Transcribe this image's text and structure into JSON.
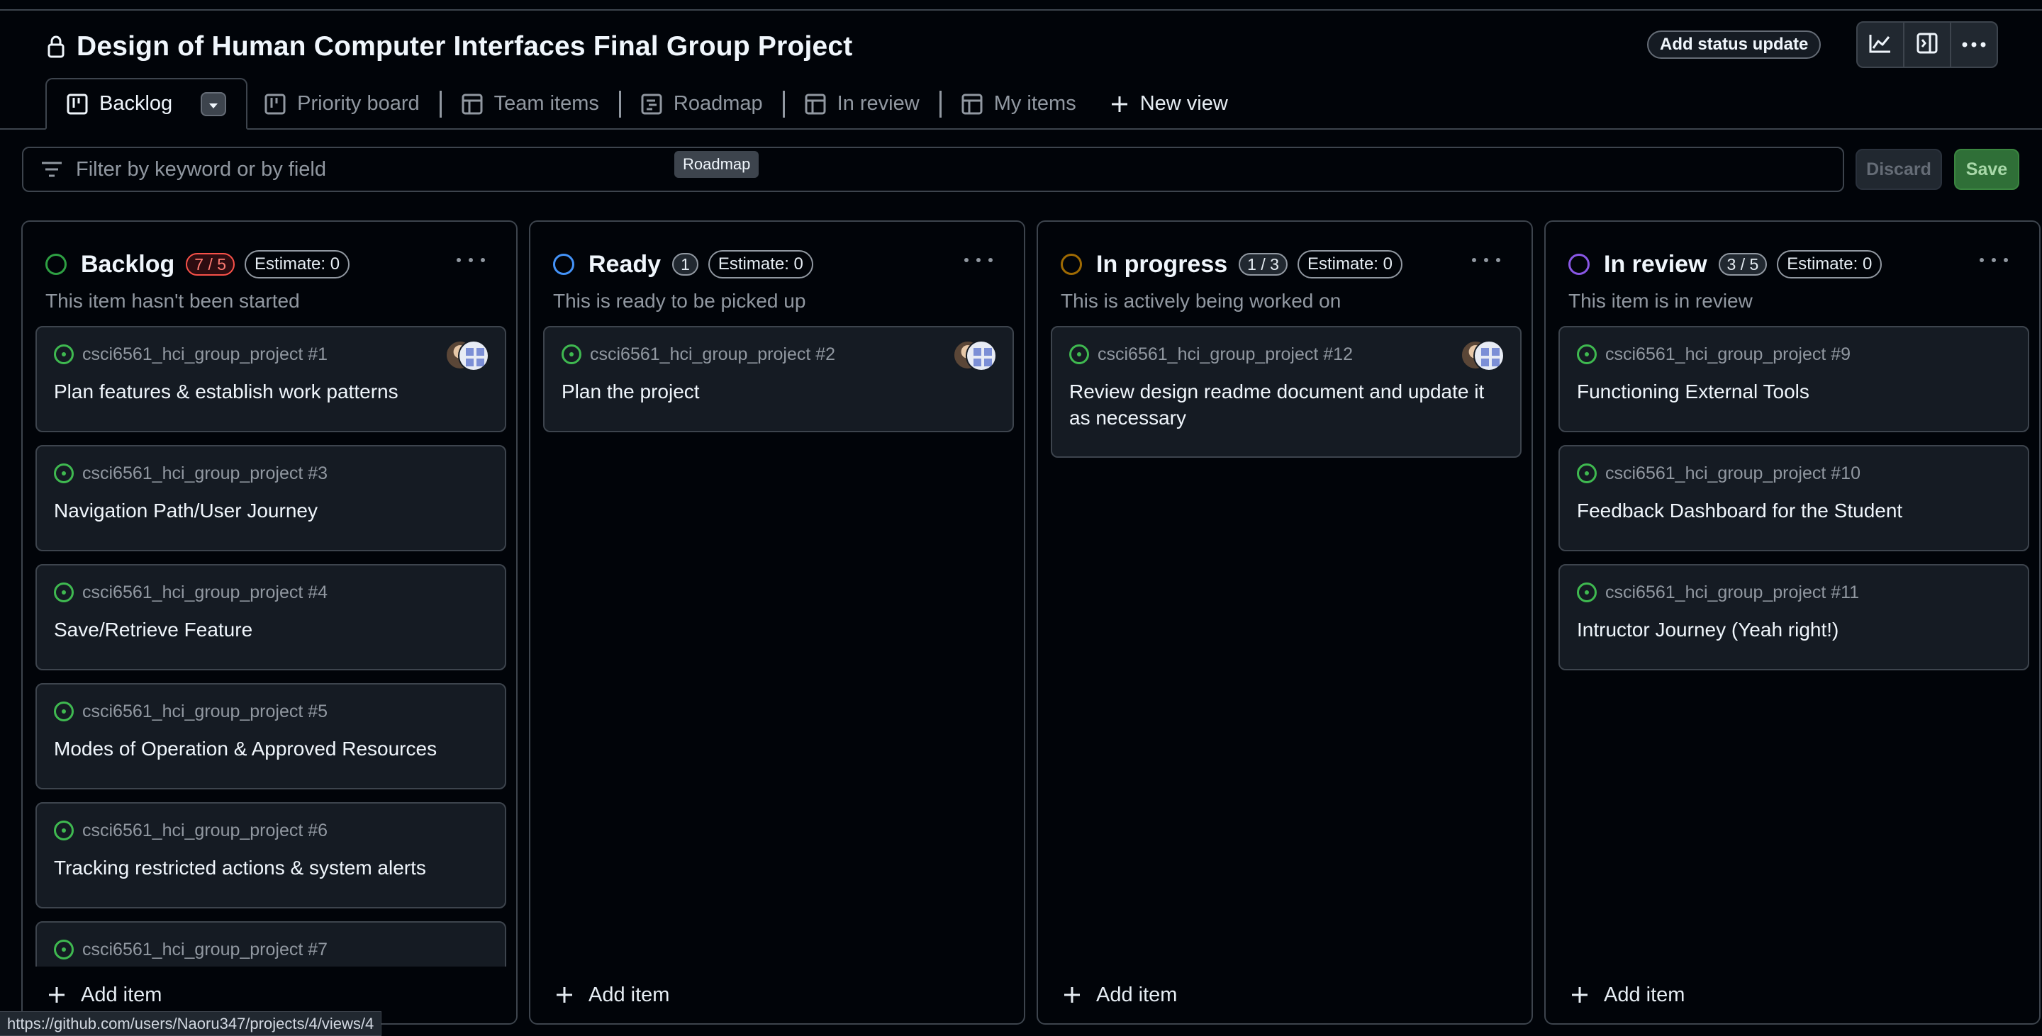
{
  "project": {
    "title": "Design of Human Computer Interfaces Final Group Project",
    "visibility_icon": "lock-icon"
  },
  "header_actions": {
    "status_update_label": "Add status update",
    "insights_icon": "graph-icon",
    "sidepanel_icon": "sidebar-expand-icon",
    "more_icon": "kebab-horizontal-icon"
  },
  "tabs": [
    {
      "label": "Backlog",
      "icon": "board-icon",
      "active": true
    },
    {
      "label": "Priority board",
      "icon": "board-icon"
    },
    {
      "label": "Team items",
      "icon": "table-icon"
    },
    {
      "label": "Roadmap",
      "icon": "roadmap-icon"
    },
    {
      "label": "In review",
      "icon": "table-icon"
    },
    {
      "label": "My items",
      "icon": "table-icon"
    }
  ],
  "new_view_label": "New view",
  "filter": {
    "placeholder": "Filter by keyword or by field"
  },
  "tooltip": "Roadmap",
  "actions": {
    "discard": "Discard",
    "save": "Save"
  },
  "columns": [
    {
      "name": "Backlog",
      "count": "7 / 5",
      "over_limit": true,
      "estimate": "Estimate: 0",
      "description": "This item hasn't been started",
      "color": "#3fb950",
      "cards": [
        {
          "repo": "csci6561_hci_group_project #1",
          "title": "Plan features & establish work patterns",
          "assignees": true
        },
        {
          "repo": "csci6561_hci_group_project #3",
          "title": "Navigation Path/User Journey"
        },
        {
          "repo": "csci6561_hci_group_project #4",
          "title": "Save/Retrieve Feature"
        },
        {
          "repo": "csci6561_hci_group_project #5",
          "title": "Modes of Operation & Approved Resources"
        },
        {
          "repo": "csci6561_hci_group_project #6",
          "title": "Tracking restricted actions & system alerts"
        },
        {
          "repo": "csci6561_hci_group_project #7",
          "title": ""
        }
      ],
      "add_item": "Add item"
    },
    {
      "name": "Ready",
      "count": "1",
      "estimate": "Estimate: 0",
      "description": "This is ready to be picked up",
      "color": "#4493f8",
      "cards": [
        {
          "repo": "csci6561_hci_group_project #2",
          "title": "Plan the project",
          "assignees": true
        }
      ],
      "add_item": "Add item"
    },
    {
      "name": "In progress",
      "count": "1 / 3",
      "estimate": "Estimate: 0",
      "description": "This is actively being worked on",
      "color": "#d29922",
      "cards": [
        {
          "repo": "csci6561_hci_group_project #12",
          "title": "Review design readme document and update it as necessary",
          "assignees": true
        }
      ],
      "add_item": "Add item"
    },
    {
      "name": "In review",
      "count": "3 / 5",
      "estimate": "Estimate: 0",
      "description": "This item is in review",
      "color": "#ab7df8",
      "cards": [
        {
          "repo": "csci6561_hci_group_project #9",
          "title": "Functioning External Tools"
        },
        {
          "repo": "csci6561_hci_group_project #10",
          "title": "Feedback Dashboard for the Student"
        },
        {
          "repo": "csci6561_hci_group_project #11",
          "title": "Intructor Journey (Yeah right!)"
        }
      ],
      "add_item": "Add item"
    }
  ],
  "status_url": "https://github.com/users/Naoru347/projects/4/views/4"
}
